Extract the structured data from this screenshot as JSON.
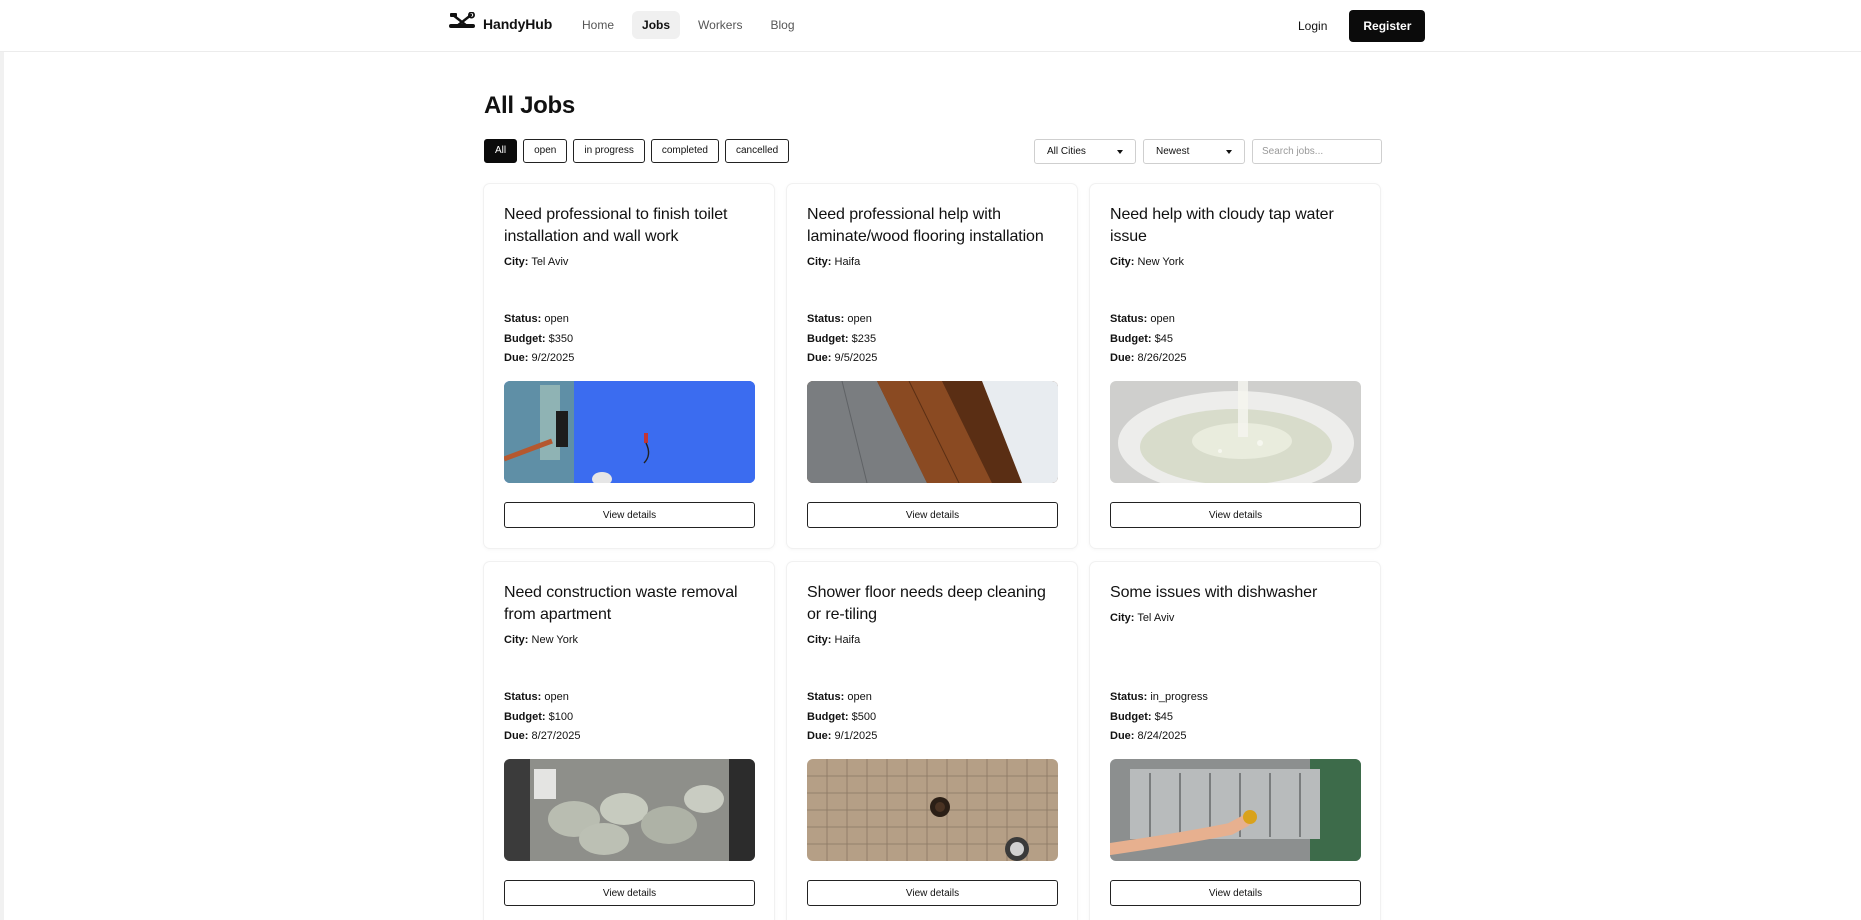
{
  "header": {
    "brand": "HandyHub",
    "nav": [
      {
        "label": "Home",
        "active": false
      },
      {
        "label": "Jobs",
        "active": true
      },
      {
        "label": "Workers",
        "active": false
      },
      {
        "label": "Blog",
        "active": false
      }
    ],
    "login_label": "Login",
    "register_label": "Register"
  },
  "page": {
    "title": "All Jobs",
    "status_filters": [
      {
        "label": "All",
        "active": true
      },
      {
        "label": "open",
        "active": false
      },
      {
        "label": "in progress",
        "active": false
      },
      {
        "label": "completed",
        "active": false
      },
      {
        "label": "cancelled",
        "active": false
      }
    ],
    "city_select": "All Cities",
    "sort_select": "Newest",
    "search_placeholder": "Search jobs..."
  },
  "labels": {
    "city": "City:",
    "status": "Status:",
    "budget": "Budget:",
    "due": "Due:",
    "view_details": "View details"
  },
  "jobs": [
    {
      "title": "Need professional to finish toilet installation and wall work",
      "city": "Tel Aviv",
      "status": "open",
      "budget": "$350",
      "due": "9/2/2025",
      "image": "blue-bathroom-construction"
    },
    {
      "title": "Need professional help with laminate/wood flooring installation",
      "city": "Haifa",
      "status": "open",
      "budget": "$235",
      "due": "9/5/2025",
      "image": "wood-floor-planks"
    },
    {
      "title": "Need help with cloudy tap water issue",
      "city": "New York",
      "status": "open",
      "budget": "$45",
      "due": "8/26/2025",
      "image": "cloudy-water-basin"
    },
    {
      "title": "Need construction waste removal from apartment",
      "city": "New York",
      "status": "open",
      "budget": "$100",
      "due": "8/27/2025",
      "image": "rubble-bags"
    },
    {
      "title": "Shower floor needs deep cleaning or re-tiling",
      "city": "Haifa",
      "status": "open",
      "budget": "$500",
      "due": "9/1/2025",
      "image": "dirty-shower-tiles"
    },
    {
      "title": "Some issues with dishwasher",
      "city": "Tel Aviv",
      "status": "in_progress",
      "budget": "$45",
      "due": "8/24/2025",
      "image": "dishwasher-repair"
    }
  ]
}
